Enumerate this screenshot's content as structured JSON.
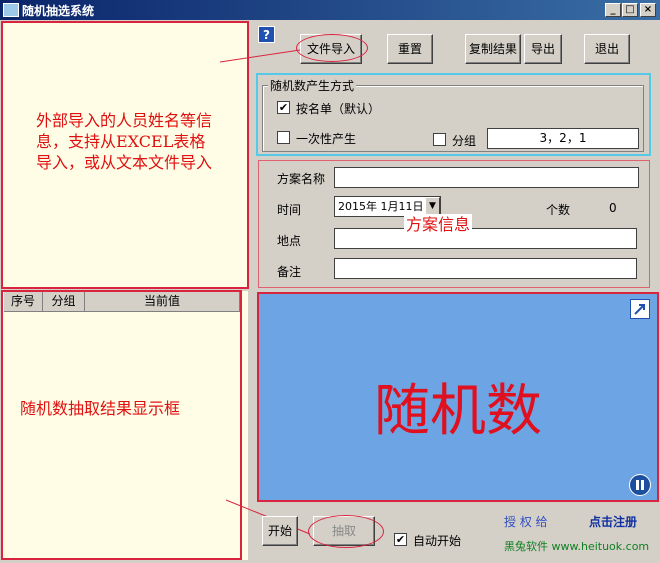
{
  "window": {
    "title": "随机抽选系统",
    "minimize_glyph": "_",
    "maximize_glyph": "□",
    "close_glyph": "×"
  },
  "toolbar": {
    "help_glyph": "?",
    "import_label": "文件导入",
    "reset_label": "重置",
    "copy_label": "复制结果",
    "export_label": "导出",
    "exit_label": "退出"
  },
  "random_mode": {
    "title": "随机数产生方式",
    "by_list_label": "按名单（默认）",
    "by_list_checked": "✔",
    "once_label": "一次性产生",
    "group_label": "分组",
    "group_value": "3，2，1"
  },
  "plan": {
    "name_label": "方案名称",
    "name_value": "",
    "time_label": "时间",
    "date_value": "2015年 1月11日",
    "count_label": "个数",
    "count_value": "0",
    "place_label": "地点",
    "place_value": "",
    "remark_label": "备注",
    "remark_value": ""
  },
  "results_table": {
    "columns": [
      "序号",
      "分组",
      "当前值"
    ]
  },
  "display": {
    "big_text": "随机数"
  },
  "bottom": {
    "start_label": "开始",
    "draw_label": "抽取",
    "auto_start_label": "自动开始",
    "auto_start_checked": "✔",
    "authorized_to_label": "授 权 给",
    "register_link": "点击注册",
    "vendor_text": "黑兔软件 www.heituok.com"
  },
  "annotations": {
    "import_note": "外部导入的人员姓名等信息，支持从EXCEL表格导入，或从文本文件导入",
    "plan_note": "方案信息",
    "results_note": "随机数抽取结果显示框"
  },
  "colors": {
    "annotation_red": "#d9243f",
    "display_blue": "#6ca4e4",
    "panel_yellow": "#fffde6"
  }
}
